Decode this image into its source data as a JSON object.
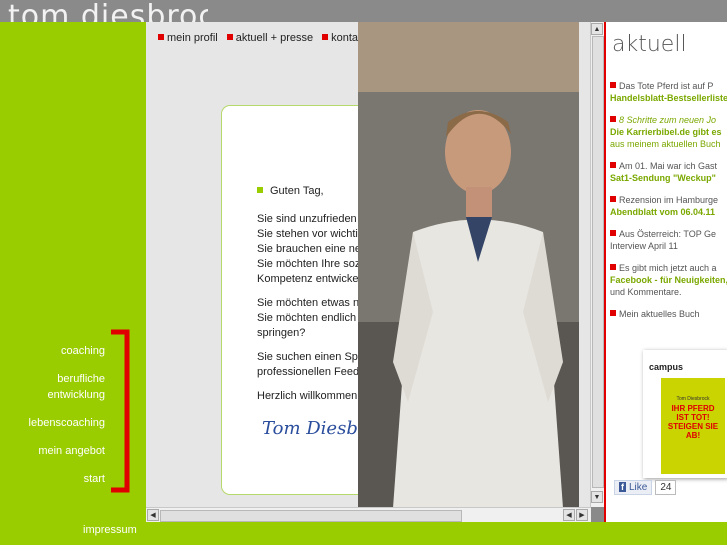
{
  "site": {
    "title": "tom diesbrock"
  },
  "sidebar": {
    "items": [
      {
        "label": "coaching"
      },
      {
        "label": "berufliche"
      },
      {
        "label": "entwicklung"
      },
      {
        "label": "lebenscoaching"
      },
      {
        "label": "mein angebot"
      },
      {
        "label": "start"
      }
    ],
    "impressum": "impressum"
  },
  "topnav": {
    "items": [
      "mein profil",
      "aktuell + presse",
      "kontakt"
    ]
  },
  "card": {
    "greeting": "Guten Tag,",
    "lines": [
      "Sie sind unzufrieden",
      "Sie stehen vor wichti",
      "Sie brauchen eine ne",
      "Sie möchten Ihre soz",
      "Kompetenz entwicke",
      "Sie möchten etwas n",
      "Sie möchten endlich",
      "springen?",
      "Sie suchen einen Sp",
      "professionellen Feed",
      "Herzlich willkommen"
    ],
    "signature": "Tom Diesbr"
  },
  "aktuell": {
    "heading": "aktuell",
    "news": [
      {
        "a": "Das Tote Pferd ist auf P",
        "b": "Handelsblatt-Bestsellerliste"
      },
      {
        "a": "8 Schritte zum neuen Jo",
        "b": "Die Karrierbibel.de gibt es",
        "c": "aus meinem aktuellen Buch"
      },
      {
        "a": "Am 01. Mai war ich Gast",
        "b": "Sat1-Sendung \"Weckup\""
      },
      {
        "a": "Rezension im Hamburge",
        "b": "Abendblatt vom 06.04.11"
      },
      {
        "a": "Aus Österreich: TOP Ge",
        "b": "Interview April 11"
      },
      {
        "a": "Es gibt mich jetzt auch a",
        "b": "Facebook - für Neuigkeiten,",
        "c": "und Kommentare."
      },
      {
        "a": "Mein aktuelles Buch"
      }
    ],
    "book": {
      "publisher": "campus",
      "author": "Tom Diesbrock",
      "title": "IHR PFERD IST TOT! STEIGEN SIE AB!"
    },
    "fb_like": "Like",
    "fb_count": "24"
  },
  "colors": {
    "green": "#9acd00",
    "red": "#e00000"
  }
}
